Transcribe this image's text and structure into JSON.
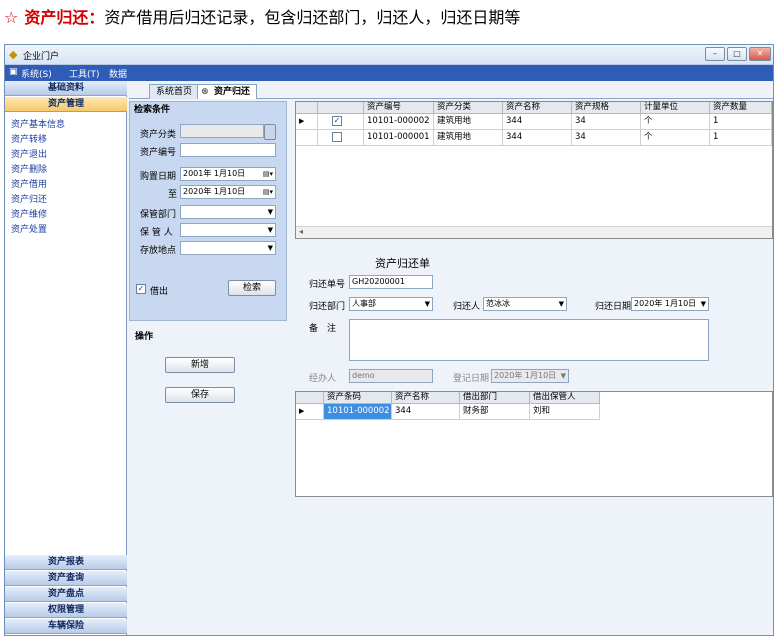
{
  "caption": {
    "star": "☆",
    "title": "资产归还：",
    "description": "资产借用后归还记录，包含归还部门，归还人，归还日期等"
  },
  "window": {
    "title": "企业门户",
    "icon": "app-icon",
    "controls": [
      "minimize",
      "maximize",
      "close"
    ]
  },
  "menu": {
    "items": [
      "系统(S)",
      "工具(T)",
      "数据"
    ]
  },
  "nav": {
    "top_headers": [
      "基础资料",
      "资产管理"
    ],
    "items": [
      "资产基本信息",
      "资产转移",
      "资产退出",
      "资产删除",
      "资产借用",
      "资产归还",
      "资产维修",
      "资产处置"
    ],
    "bottom_headers": [
      "资产报表",
      "资产查询",
      "资产盘点",
      "权限管理",
      "车辆保险"
    ]
  },
  "tabs": [
    {
      "label": "系统首页"
    },
    {
      "label": "资产归还"
    }
  ],
  "search": {
    "header": "检索条件",
    "category_label": "资产分类",
    "code_label": "资产编号",
    "purchase_date_label": "购置日期",
    "date_from": "2001年 1月10日",
    "to_label": "至",
    "date_to": "2020年 1月10日",
    "dept_label": "保管部门",
    "keeper_label": "保 管 人",
    "location_label": "存放地点",
    "borrow_label": "借出",
    "borrow_checked": true,
    "search_button": "检索"
  },
  "ops": {
    "header": "操作",
    "add_button": "新增",
    "save_button": "保存"
  },
  "top_grid": {
    "columns": [
      "资产编号",
      "资产分类",
      "资产名称",
      "资产规格",
      "计量单位",
      "资产数量"
    ],
    "rows": [
      {
        "checked": true,
        "cells": [
          "10101-000002",
          "建筑用地",
          "344",
          "34",
          "个",
          "1"
        ]
      },
      {
        "checked": false,
        "cells": [
          "10101-000001",
          "建筑用地",
          "344",
          "34",
          "个",
          "1"
        ]
      }
    ]
  },
  "return_form": {
    "title": "资产归还单",
    "number_label": "归还单号",
    "number_value": "GH20200001",
    "dept_label": "归还部门",
    "dept_value": "人事部",
    "person_label": "归还人",
    "person_value": "范冰冰",
    "date_label": "归还日期",
    "date_value": "2020年 1月10日",
    "remark_label": "备　注",
    "handler_label": "经办人",
    "handler_value": "demo",
    "reg_date_label": "登记日期",
    "reg_date_value": "2020年 1月10日"
  },
  "bottom_grid": {
    "columns": [
      "资产条码",
      "资产名称",
      "借出部门",
      "借出保管人"
    ],
    "rows": [
      {
        "cells": [
          "10101-000002",
          "344",
          "财务部",
          "刘和"
        ]
      }
    ]
  }
}
